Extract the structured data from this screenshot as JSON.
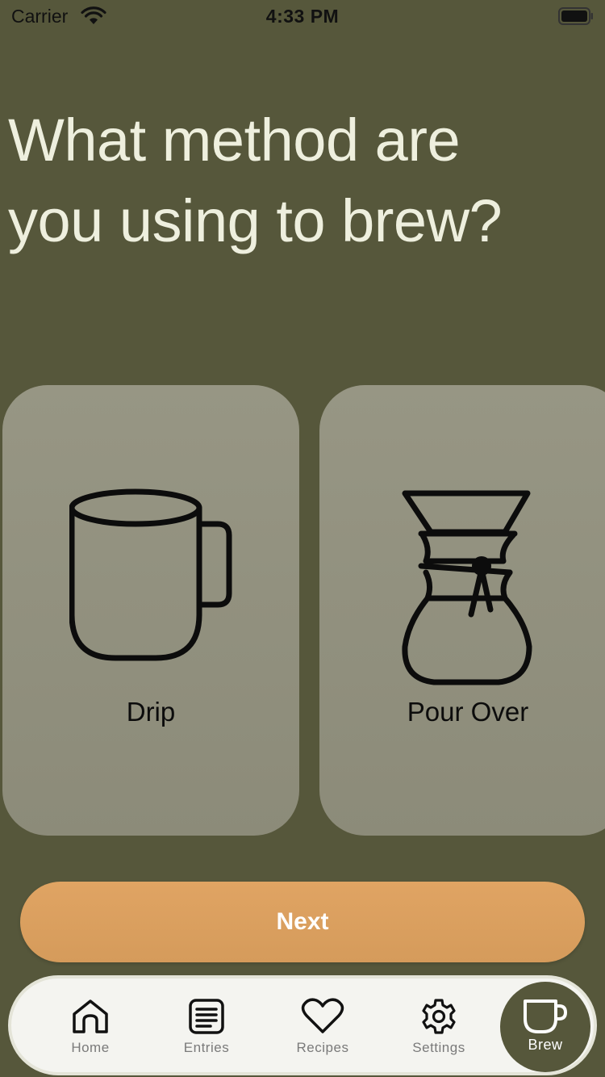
{
  "status_bar": {
    "carrier": "Carrier",
    "time": "4:33 PM"
  },
  "title": "What method are you using to brew?",
  "methods": [
    {
      "label": "Drip",
      "icon": "mug-icon"
    },
    {
      "label": "Pour Over",
      "icon": "chemex-icon"
    }
  ],
  "next_button": {
    "label": "Next"
  },
  "tab_bar": {
    "items": [
      {
        "label": "Home",
        "icon": "home-icon"
      },
      {
        "label": "Entries",
        "icon": "list-icon"
      },
      {
        "label": "Recipes",
        "icon": "heart-icon"
      },
      {
        "label": "Settings",
        "icon": "gear-icon"
      },
      {
        "label": "Brew",
        "icon": "cup-icon",
        "active": true
      }
    ]
  },
  "colors": {
    "background": "#56573b",
    "card": "#918f7e",
    "accent": "#de9f5e",
    "tab_bar": "#f4f4f0"
  }
}
